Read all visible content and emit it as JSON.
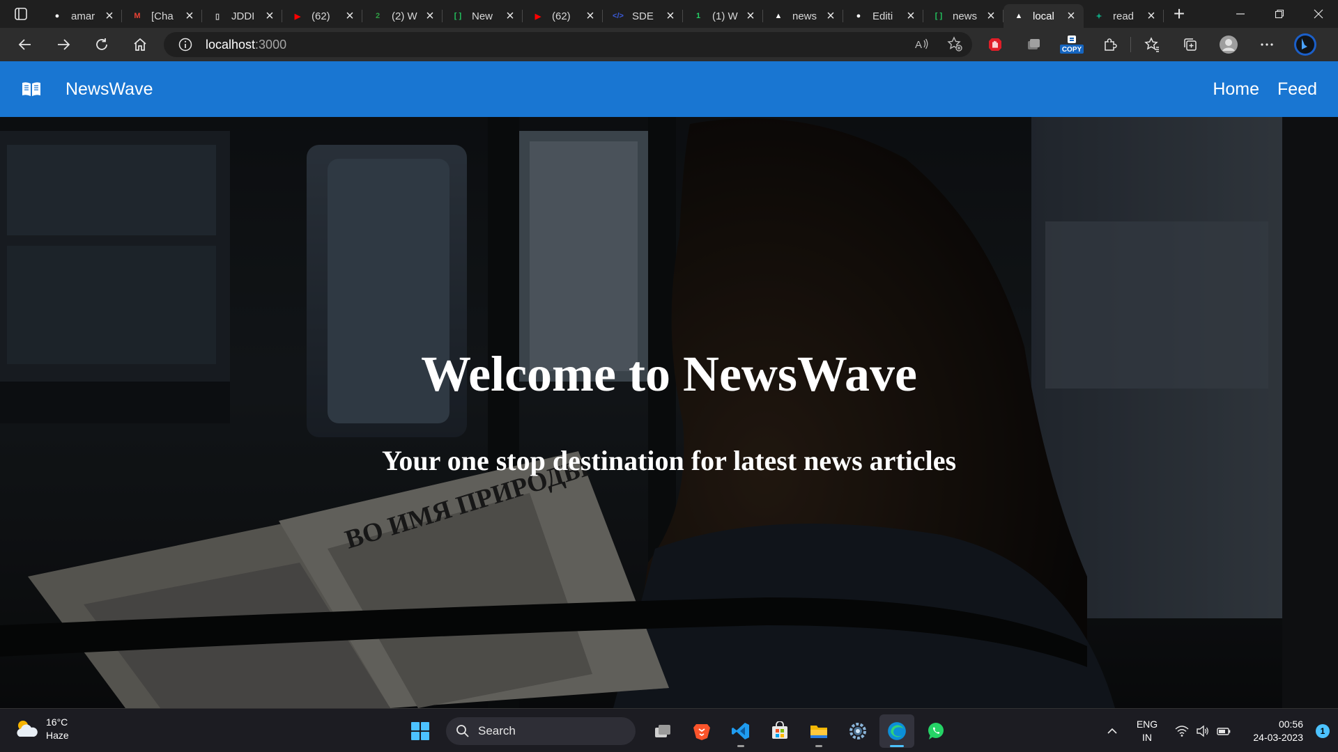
{
  "browser": {
    "tabs": [
      {
        "title": "amar",
        "icon": "github-icon",
        "color": "#ffffff"
      },
      {
        "title": "[Cha",
        "icon": "gmail-icon",
        "color": "#ea4335"
      },
      {
        "title": "JDDI",
        "icon": "document-icon",
        "color": "#cfcfcf"
      },
      {
        "title": "(62)",
        "icon": "youtube-icon",
        "color": "#ff0000"
      },
      {
        "title": "(2) W",
        "icon": "chat-icon",
        "color": "#2f9e44"
      },
      {
        "title": "New",
        "icon": "bracket-icon",
        "color": "#22c55e"
      },
      {
        "title": "(62)",
        "icon": "youtube-icon",
        "color": "#ff0000"
      },
      {
        "title": "SDE",
        "icon": "code-icon",
        "color": "#3b5bdb"
      },
      {
        "title": "(1) W",
        "icon": "whatsapp-icon",
        "color": "#25d366"
      },
      {
        "title": "news",
        "icon": "triangle-icon",
        "color": "#ffffff"
      },
      {
        "title": "Editi",
        "icon": "github-icon",
        "color": "#ffffff"
      },
      {
        "title": "news",
        "icon": "bracket-icon",
        "color": "#22c55e"
      },
      {
        "title": "local",
        "icon": "triangle-icon",
        "color": "#ffffff",
        "active": true
      },
      {
        "title": "read",
        "icon": "chatgpt-icon",
        "color": "#10a37f"
      }
    ],
    "address": {
      "host": "localhost",
      "port": ":3000"
    },
    "copy_badge": "COPY"
  },
  "site": {
    "brand": "NewsWave",
    "nav": {
      "home": "Home",
      "feed": "Feed"
    },
    "hero": {
      "title": "Welcome to NewsWave",
      "subtitle": "Your one stop destination for latest news articles",
      "newspaper_headline": "ВО ИМЯ ПРИРОДЫ"
    },
    "accent": "#1976d2"
  },
  "taskbar": {
    "weather": {
      "temp": "16°C",
      "condition": "Haze"
    },
    "search_label": "Search",
    "language": {
      "line1": "ENG",
      "line2": "IN"
    },
    "clock": {
      "time": "00:56",
      "date": "24-03-2023"
    },
    "notification_count": "1"
  }
}
